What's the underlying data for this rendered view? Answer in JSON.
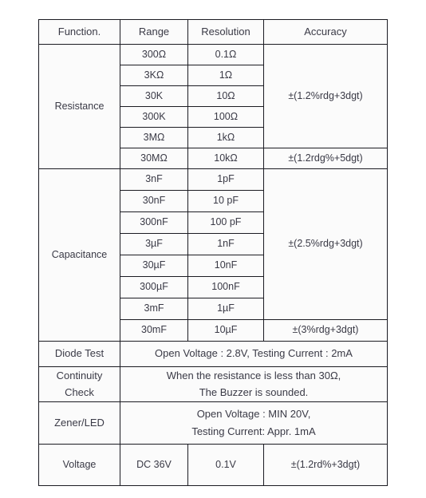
{
  "table": {
    "headers": [
      "Function.",
      "Range",
      "Resolution",
      "Accuracy"
    ],
    "resistance": {
      "label": "Resistance",
      "rows": [
        {
          "range": "300Ω",
          "resolution": "0.1Ω"
        },
        {
          "range": "3KΩ",
          "resolution": "1Ω"
        },
        {
          "range": "30K",
          "resolution": "10Ω"
        },
        {
          "range": "300K",
          "resolution": "100Ω"
        },
        {
          "range": "3MΩ",
          "resolution": "1kΩ"
        },
        {
          "range": "30MΩ",
          "resolution": "10kΩ"
        }
      ],
      "accuracy_main": "±(1.2%rdg+3dgt)",
      "accuracy_last": "±(1.2rdg%+5dgt)"
    },
    "capacitance": {
      "label": "Capacitance",
      "rows": [
        {
          "range": "3nF",
          "resolution": "1pF"
        },
        {
          "range": "30nF",
          "resolution": "10 pF"
        },
        {
          "range": "300nF",
          "resolution": "100 pF"
        },
        {
          "range": "3µF",
          "resolution": "1nF"
        },
        {
          "range": "30µF",
          "resolution": "10nF"
        },
        {
          "range": "300µF",
          "resolution": "100nF"
        },
        {
          "range": "3mF",
          "resolution": "1µF"
        },
        {
          "range": "30mF",
          "resolution": "10µF"
        }
      ],
      "accuracy_main": "±(2.5%rdg+3dgt)",
      "accuracy_last": "±(3%rdg+3dgt)"
    },
    "diode_test": {
      "label": "Diode Test",
      "detail": "Open Voltage : 2.8V, Testing Current : 2mA"
    },
    "continuity_check": {
      "label_line1": "Continuity",
      "label_line2": "Check",
      "detail_line1": "When the resistance is less than 30Ω,",
      "detail_line2": "The Buzzer is sounded."
    },
    "zener_led": {
      "label": "Zener/LED",
      "detail_line1": "Open Voltage :   MIN  20V,",
      "detail_line2": "Testing Current:  Appr. 1mA"
    },
    "voltage": {
      "label": "Voltage",
      "range": "DC 36V",
      "resolution": "0.1V",
      "accuracy": "±(1.2rd%+3dgt)"
    }
  }
}
